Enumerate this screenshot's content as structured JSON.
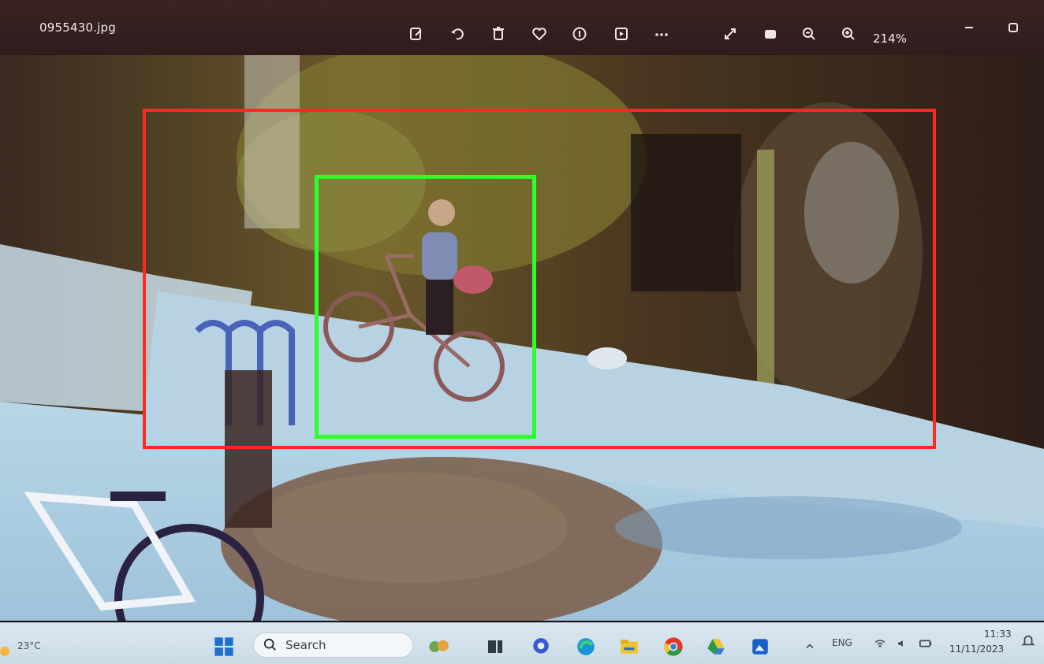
{
  "viewer": {
    "filename": "0955430.jpg",
    "zoom": "214%",
    "toolbar_icons": [
      "edit-icon",
      "rotate-icon",
      "delete-icon",
      "favorite-icon",
      "info-icon",
      "slideshow-icon",
      "more-icon",
      "fullscreen-icon",
      "fit-icon",
      "zoom-out-icon",
      "zoom-in-icon"
    ],
    "window_icons": [
      "minimize-icon",
      "restore-icon"
    ]
  },
  "detections": {
    "red_box_color": "#ff2a1f",
    "green_box_color": "#2cff2c"
  },
  "taskbar": {
    "weather_temp": "23°C",
    "weather_date": "(blurred)",
    "search_label": "Search",
    "language": "ENG",
    "time": "11:33",
    "date": "11/11/2023"
  }
}
